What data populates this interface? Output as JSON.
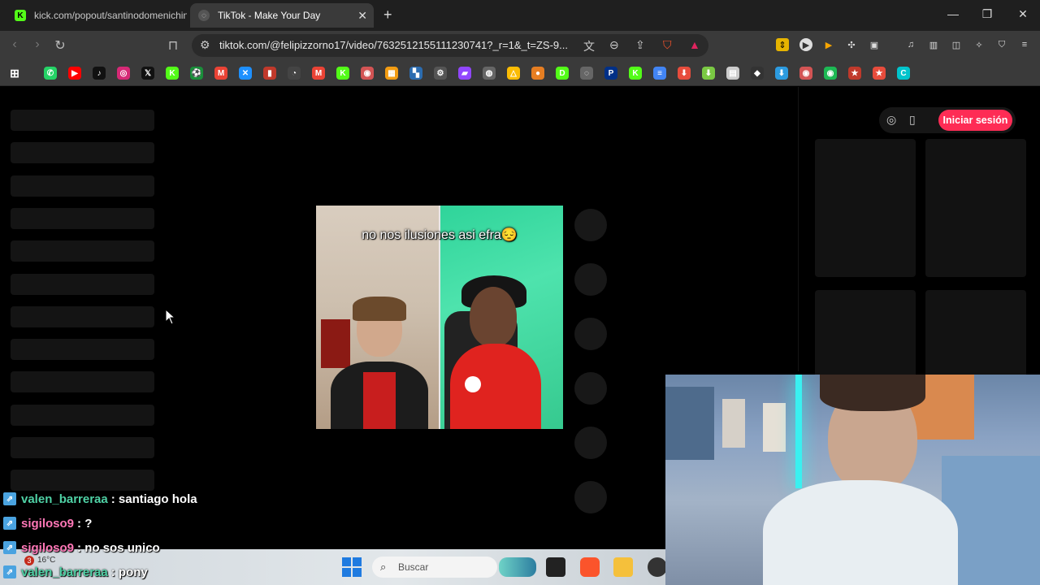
{
  "browser": {
    "tabs": [
      {
        "title": "kick.com/popout/santinodomenichin",
        "active": false,
        "favicon": "kick-logo-icon"
      },
      {
        "title": "TikTok - Make Your Day",
        "active": true,
        "favicon": "tiktok-icon"
      }
    ],
    "url": "tiktok.com/@felipizzorno17/video/7632512155111230741?_r=1&_t=ZS-9...",
    "window_controls": {
      "minimize": "—",
      "maximize": "❐",
      "close": "✕"
    }
  },
  "bookmarks": [
    "whatsapp-icon",
    "youtube-icon",
    "tiktok-icon",
    "instagram-icon",
    "x-icon",
    "kick-icon",
    "soccer-icon",
    "gmail-icon",
    "extension-icon",
    "analytics-icon",
    "speed-icon",
    "gmail-icon",
    "kick-icon",
    "record-icon",
    "photo-icon",
    "grid-icon",
    "settings-icon",
    "twitch-icon",
    "github-icon",
    "drive-icon",
    "flame-icon",
    "d-icon",
    "globe-icon",
    "paypal-icon",
    "kick-icon",
    "docs-icon",
    "download-icon",
    "download-green-icon",
    "file-icon",
    "diamond-icon",
    "download-blue-icon",
    "record-icon",
    "spotify-icon",
    "star-icon",
    "star-icon",
    "canva-icon"
  ],
  "tiktok": {
    "login_label": "Iniciar sesión",
    "video_caption": "no nos ilusiones asi efra😔"
  },
  "chat": [
    {
      "user": "valen_barreraa",
      "message": ": santiago hola",
      "color": "#4fd1a5"
    },
    {
      "user": "sigiloso9",
      "message": ": ?",
      "color": "#ff77b7"
    },
    {
      "user": "sigiloso9",
      "message": ": no sos unico",
      "color": "#ff77b7"
    },
    {
      "user": "valen_barreraa",
      "message": ": pony",
      "color": "#4fd1a5"
    }
  ],
  "taskbar": {
    "search_placeholder": "Buscar",
    "weather": "16°C",
    "notification_count": "3"
  }
}
